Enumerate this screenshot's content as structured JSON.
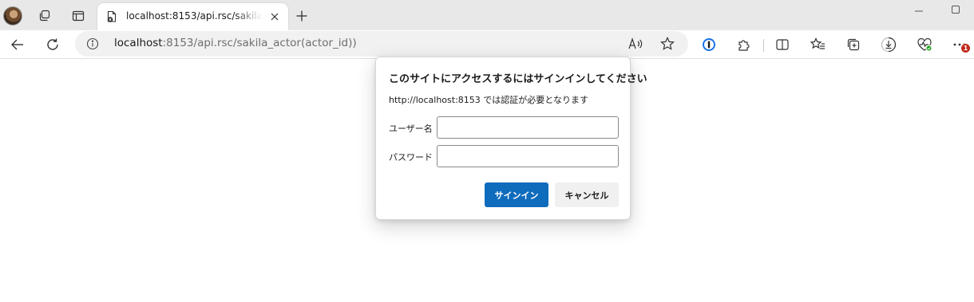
{
  "browser": {
    "tab": {
      "title": "localhost:8153/api.rsc/sakila_actor(actor_id)"
    },
    "address_bar": {
      "host": "localhost",
      "rest": ":8153/api.rsc/sakila_actor(actor_id))"
    },
    "notification_count": "1",
    "icons": {
      "profile": "avatar",
      "workspaces": "workspaces-icon",
      "tab_actions": "tab-actions-icon",
      "favicon": "page-error-icon",
      "tab_close": "close-icon",
      "new_tab": "plus-icon",
      "minimize": "minimize-icon",
      "maximize": "maximize-icon",
      "back": "arrow-left-icon",
      "refresh": "refresh-icon",
      "site_info": "info-icon",
      "read_aloud": "read-aloud-icon",
      "favorite": "star-icon",
      "password_manager": "1password-icon",
      "extensions": "puzzle-icon",
      "split_screen": "split-screen-icon",
      "favorites": "favorites-list-icon",
      "collections": "collections-icon",
      "downloads": "download-icon",
      "browser_essentials": "heart-pulse-icon",
      "menu": "more-icon"
    },
    "colors": {
      "primary_button": "#0f6cbd",
      "badge": "#c42b1c"
    }
  },
  "dialog": {
    "title": "このサイトにアクセスするにはサインインしてください",
    "message": "http://localhost:8153 では認証が必要となります",
    "username_label": "ユーザー名",
    "username_value": "",
    "password_label": "パスワード",
    "password_value": "",
    "sign_in_label": "サインイン",
    "cancel_label": "キャンセル"
  }
}
